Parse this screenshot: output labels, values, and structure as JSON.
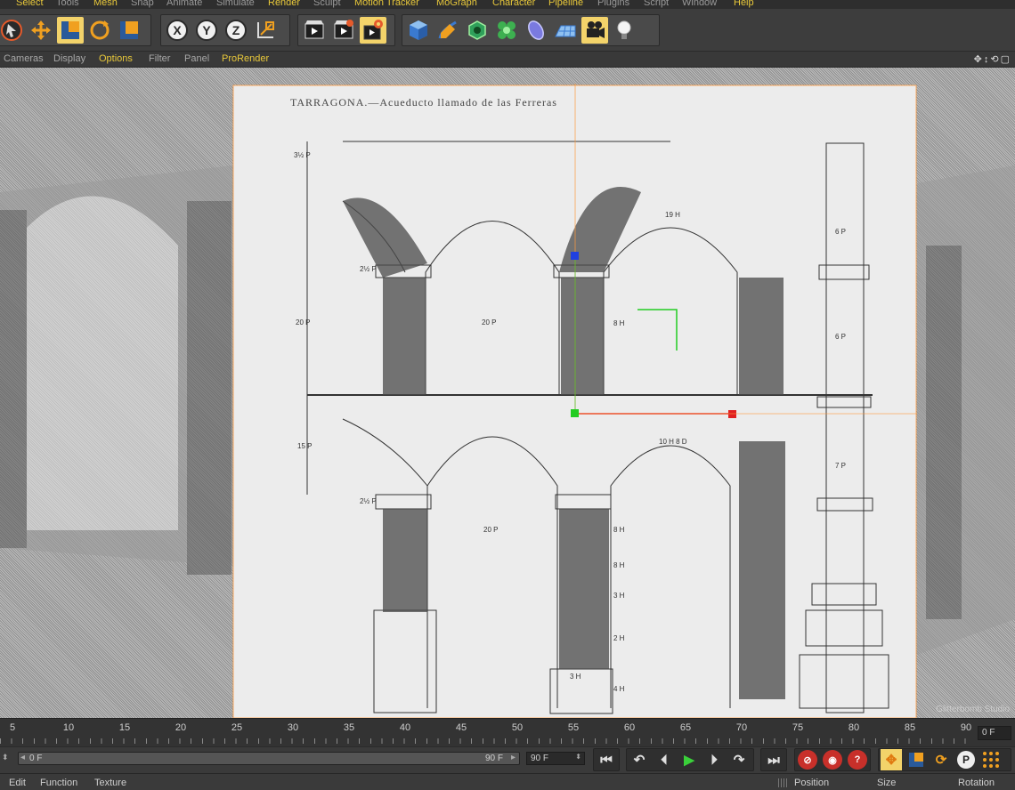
{
  "menu": {
    "items": [
      "Select",
      "Tools",
      "Mesh",
      "Snap",
      "Animate",
      "Simulate",
      "Render",
      "Sculpt",
      "Motion Tracker",
      "MoGraph",
      "Character",
      "Pipeline",
      "Plugins",
      "Script",
      "Window",
      "Help"
    ]
  },
  "toolbar": {
    "groups": [
      {
        "name": "selection",
        "buttons": [
          "live-selection-icon",
          "move-icon",
          "scale-icon",
          "rotate-icon",
          "last-tool-icon"
        ]
      },
      {
        "name": "axis",
        "buttons": [
          "x-axis-icon",
          "y-axis-icon",
          "z-axis-icon",
          "coordinate-system-icon"
        ]
      },
      {
        "name": "render",
        "buttons": [
          "render-view-icon",
          "render-picture-viewer-icon",
          "edit-render-settings-icon"
        ]
      },
      {
        "name": "create",
        "buttons": [
          "cube-icon",
          "pen-icon",
          "subdivision-icon",
          "cloner-icon",
          "deformer-icon",
          "floor-icon",
          "camera-icon",
          "light-icon"
        ]
      }
    ]
  },
  "viewport_menu": {
    "items": [
      "Cameras",
      "Display",
      "Options",
      "Filter",
      "Panel",
      "ProRender"
    ],
    "nav_tools": "✥↕⟲▢"
  },
  "viewport": {
    "blueprint_title": "TARRAGONA.—Acueducto llamado de las Ferreras",
    "dimension_labels": [
      "3½ P",
      "2½ P",
      "20 P",
      "20 P",
      "8 H",
      "19 H",
      "15 P",
      "2½ P",
      "20 P",
      "10 H 8 D",
      "8 H",
      "8 H",
      "3 H",
      "2 H",
      "4 H",
      "3 H",
      "7 P",
      "6 P",
      "6 P"
    ],
    "watermark": "Glitterbomb Studio"
  },
  "timeline": {
    "ticks": [
      "5",
      "10",
      "15",
      "20",
      "25",
      "30",
      "35",
      "40",
      "45",
      "50",
      "55",
      "60",
      "65",
      "70",
      "75",
      "80",
      "85",
      "90"
    ],
    "current_frame": "0 F"
  },
  "playback": {
    "range_start": "0 F",
    "range_end": "90 F",
    "end_frame": "90 F",
    "buttons": [
      "go-to-start-icon",
      "previous-key-icon",
      "previous-frame-icon",
      "play-forward-icon",
      "next-frame-icon",
      "next-key-icon",
      "go-to-end-icon"
    ],
    "record_buttons": [
      "record-active-objects-icon",
      "autokeying-icon",
      "keyframe-selection-icon"
    ],
    "key_buttons": [
      "position-key-icon",
      "scale-key-icon",
      "rotation-key-icon",
      "parameter-key-icon",
      "point-level-animation-icon"
    ],
    "param_key_label": "P"
  },
  "bottom": {
    "left_tabs": [
      "Edit",
      "Function",
      "Texture"
    ],
    "coordinate_headers": [
      "Position",
      "Size",
      "Rotation"
    ]
  },
  "colors": {
    "accent_yellow": "#e8c83a",
    "active_button": "#f3d36a",
    "axis_x": "#e02020",
    "axis_y": "#22cc22",
    "axis_z": "#2040e0",
    "frame_orange": "#ff9a3c"
  }
}
